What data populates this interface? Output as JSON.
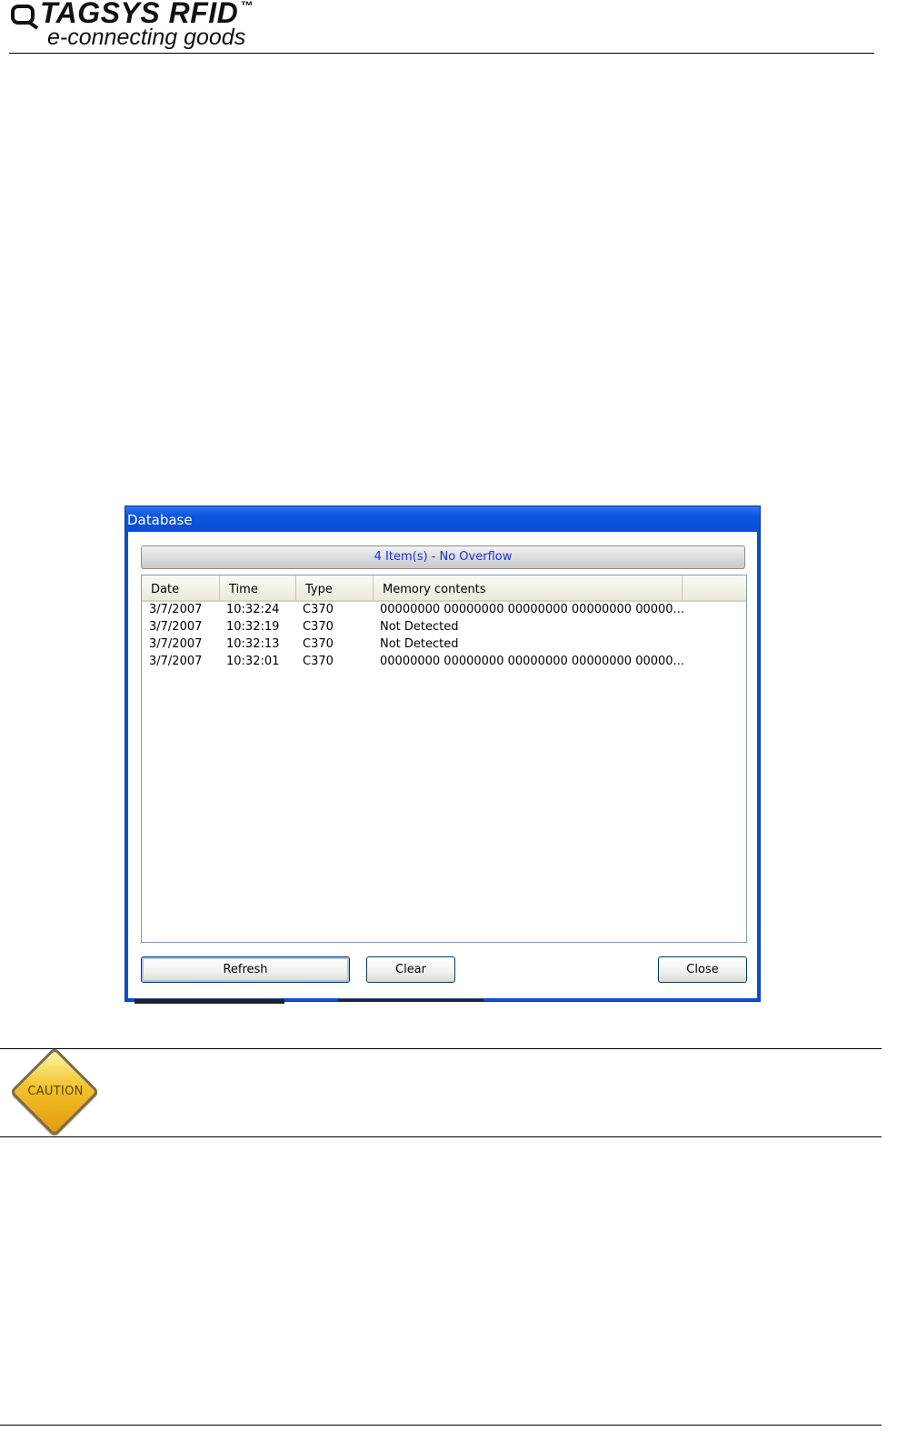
{
  "header": {
    "brand": "TAGSYS RFID",
    "trademark": "™",
    "tagline": "e-connecting goods"
  },
  "dialog": {
    "title": "Database",
    "status": "4 Item(s) - No Overflow",
    "columns": [
      "Date",
      "Time",
      "Type",
      "Memory contents"
    ],
    "rows": [
      {
        "date": "3/7/2007",
        "time": "10:32:24",
        "type": "C370",
        "memory": "00000000 00000000 00000000 00000000 00000..."
      },
      {
        "date": "3/7/2007",
        "time": "10:32:19",
        "type": "C370",
        "memory": "Not Detected"
      },
      {
        "date": "3/7/2007",
        "time": "10:32:13",
        "type": "C370",
        "memory": "Not Detected"
      },
      {
        "date": "3/7/2007",
        "time": "10:32:01",
        "type": "C370",
        "memory": "00000000 00000000 00000000 00000000 00000..."
      }
    ],
    "buttons": {
      "refresh": "Refresh",
      "clear": "Clear",
      "close": "Close"
    }
  },
  "caution": {
    "label": "CAUTION"
  },
  "colors": {
    "titlebar": "#0a55de",
    "status_text": "#1f2de0",
    "caution_fill": "#f2c22a"
  }
}
